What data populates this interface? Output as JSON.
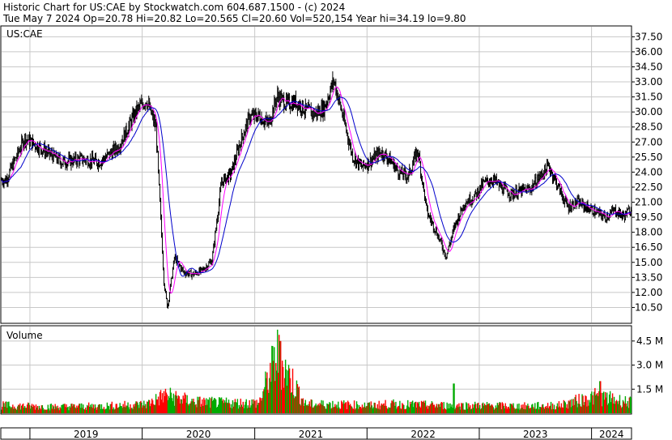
{
  "header": {
    "line1": "Historic Chart for US:CAE by Stockwatch.com 604.687.1500 - (c) 2024",
    "line2": "Tue May  7 2024  Op=20.78  Hi=20.82  Lo=20.565  Cl=20.60  Vol=520,154  Year hi=34.19  lo=9.80"
  },
  "price_panel": {
    "symbol": "US:CAE"
  },
  "volume_panel": {
    "title": "Volume"
  },
  "colors": {
    "price_bars": "#000000",
    "ma_short": "#ff00ff",
    "ma_long": "#0000cc",
    "volume_up": "#00aa00",
    "volume_down": "#ff0000",
    "grid": "#c8c8c8",
    "frame": "#000000"
  },
  "chart_data": [
    {
      "type": "line",
      "title": "Historic Chart for US:CAE",
      "description_note": "",
      "ylim": [
        9.0,
        38.5
      ],
      "y_ticks": [
        "10.50",
        "12.00",
        "13.50",
        "15.00",
        "16.50",
        "18.00",
        "19.50",
        "21.00",
        "22.50",
        "24.00",
        "25.50",
        "27.00",
        "28.50",
        "30.00",
        "31.50",
        "33.00",
        "34.50",
        "36.00",
        "37.50"
      ],
      "x_labels": [
        "2019",
        "2020",
        "2021",
        "2022",
        "2023",
        "2024"
      ],
      "x": [
        "2018-10",
        "2018-12",
        "2019-02",
        "2019-04",
        "2019-06",
        "2019-08",
        "2019-10",
        "2019-12",
        "2020-01",
        "2020-02",
        "2020-03-12",
        "2020-03-23",
        "2020-04",
        "2020-05",
        "2020-06",
        "2020-07",
        "2020-08",
        "2020-09",
        "2020-10",
        "2020-11",
        "2020-12",
        "2021-01",
        "2021-02",
        "2021-03",
        "2021-04",
        "2021-05",
        "2021-06",
        "2021-07",
        "2021-08",
        "2021-09",
        "2021-10",
        "2021-11",
        "2021-12",
        "2022-01",
        "2022-02",
        "2022-03",
        "2022-04",
        "2022-05",
        "2022-06",
        "2022-07",
        "2022-08",
        "2022-09",
        "2022-10",
        "2022-11",
        "2022-12",
        "2023-01",
        "2023-02",
        "2023-03",
        "2023-04",
        "2023-05",
        "2023-06",
        "2023-07",
        "2023-08",
        "2023-09",
        "2023-10",
        "2023-11",
        "2023-12",
        "2024-01",
        "2024-02",
        "2024-03",
        "2024-04",
        "2024-05"
      ],
      "series": [
        {
          "name": "",
          "values": [
            23.2,
            27.4,
            26.2,
            25.0,
            25.3,
            25.0,
            26.5,
            30.2,
            31.2,
            28.4,
            13.0,
            10.5,
            15.5,
            14.0,
            13.8,
            14.2,
            15.2,
            23.0,
            23.8,
            27.0,
            29.5,
            29.6,
            28.8,
            31.6,
            30.8,
            31.0,
            30.2,
            29.8,
            30.4,
            33.2,
            29.5,
            25.6,
            24.5,
            25.2,
            26.0,
            25.3,
            24.0,
            23.6,
            26.2,
            20.0,
            18.0,
            15.6,
            18.8,
            21.0,
            21.5,
            22.9,
            23.3,
            22.4,
            21.8,
            22.1,
            22.3,
            23.5,
            24.6,
            22.5,
            20.5,
            21.0,
            20.5,
            20.0,
            19.5,
            20.2,
            19.6,
            20.6
          ]
        },
        {
          "name": "",
          "values": []
        },
        {
          "name": "",
          "values": []
        }
      ]
    },
    {
      "type": "bar",
      "title": "Volume",
      "y_ticks": [
        "1.5 M",
        "3.0 M",
        "4.5 M"
      ],
      "ylim": [
        0,
        5.4
      ],
      "x": [
        "2018-10",
        "2019-03",
        "2019-08",
        "2020-01",
        "2020-03",
        "2020-06",
        "2020-09",
        "2021-01",
        "2021-03",
        "2021-06",
        "2021-09",
        "2022-01",
        "2022-03",
        "2022-06",
        "2022-09",
        "2023-01",
        "2023-05",
        "2023-09",
        "2024-01",
        "2024-05"
      ],
      "values": [
        0.6,
        0.5,
        0.55,
        0.7,
        1.4,
        0.9,
        0.8,
        0.8,
        4.5,
        0.7,
        0.7,
        0.6,
        0.7,
        0.65,
        0.6,
        0.6,
        0.55,
        0.6,
        1.3,
        0.8
      ]
    }
  ]
}
